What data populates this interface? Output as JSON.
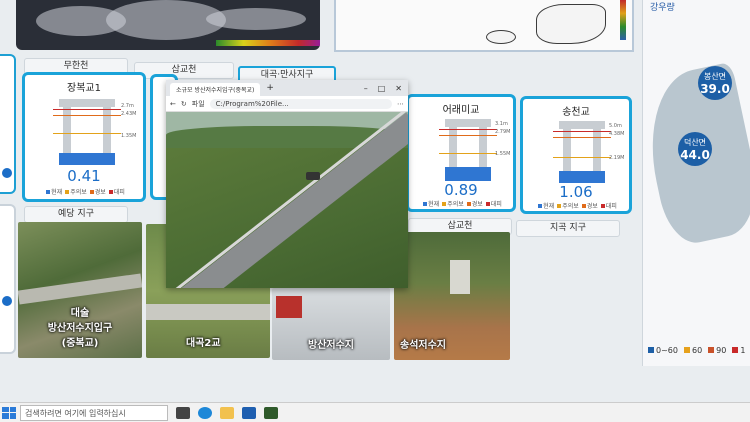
{
  "top": {
    "region_label": "강우량"
  },
  "tabs": [
    "무한천",
    "삽교천",
    "대곡·만사지구",
    "예당 지구",
    "삽교천",
    "지곡 지구"
  ],
  "gauges": [
    {
      "name": "장복교1",
      "value": "0.41",
      "levels": [
        "2.7m",
        "2.43M",
        "1.35M"
      ]
    },
    {
      "name": "어래미교",
      "value": "0.89",
      "levels": [
        "3.1m",
        "2.79M",
        "1.55M"
      ]
    },
    {
      "name": "송천교",
      "value": "1.06",
      "levels": [
        "5.0m",
        "4.38M",
        "2.19M"
      ]
    }
  ],
  "gauge_legend": [
    "현재",
    "주의보",
    "경보",
    "대피"
  ],
  "level_colors": {
    "current": "#2f76d2",
    "advisory": "#e3a21a",
    "warning": "#e06b1a",
    "evacuate": "#c92a2a"
  },
  "rainfall": [
    {
      "name": "봉산면",
      "value": "39.0"
    },
    {
      "name": "덕산면",
      "value": "44.0"
    }
  ],
  "rain_legend": [
    "0~60",
    "60",
    "90",
    "1"
  ],
  "rain_legend_colors": [
    "#1d5fa6",
    "#e6a11c",
    "#c9522a",
    "#c92a2a"
  ],
  "photos": [
    {
      "label": "대술\n방산저수지입구\n(중복교)"
    },
    {
      "label": "대곡2교"
    },
    {
      "label": "방산저수지"
    },
    {
      "label": "송석저수지"
    }
  ],
  "browser": {
    "tab_title": "소규모 방산저수지입구(중복교)",
    "url": "C:/Program%20File...",
    "file_label": "파일"
  },
  "taskbar": {
    "search_placeholder": "검색하려면 여기에 입력하십시"
  }
}
